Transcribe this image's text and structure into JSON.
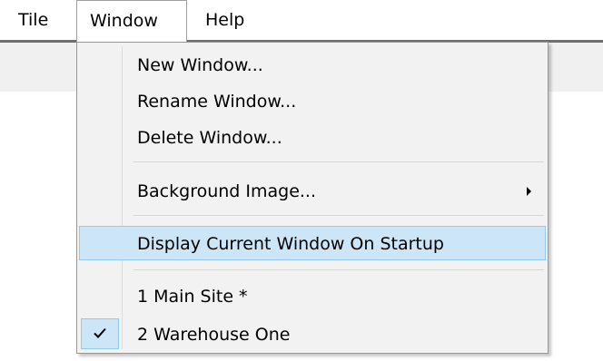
{
  "menubar": {
    "items": [
      {
        "label": "Tile"
      },
      {
        "label": "Window"
      },
      {
        "label": "Help"
      }
    ]
  },
  "window_menu": {
    "items": [
      {
        "label": "New Window..."
      },
      {
        "label": "Rename Window..."
      },
      {
        "label": "Delete Window..."
      },
      {
        "label": "Background Image...",
        "has_submenu": true
      },
      {
        "label": "Display Current Window On Startup",
        "highlighted": true
      },
      {
        "label": "1 Main Site *",
        "checked": false
      },
      {
        "label": "2 Warehouse One",
        "checked": true
      }
    ]
  },
  "colors": {
    "highlight_fill": "#cde6f7",
    "highlight_border": "#90c8f6",
    "menu_background": "#f2f2f2"
  },
  "icons": {
    "submenu_indicator": "chevron-right-icon",
    "checked_indicator": "checkmark-icon"
  }
}
